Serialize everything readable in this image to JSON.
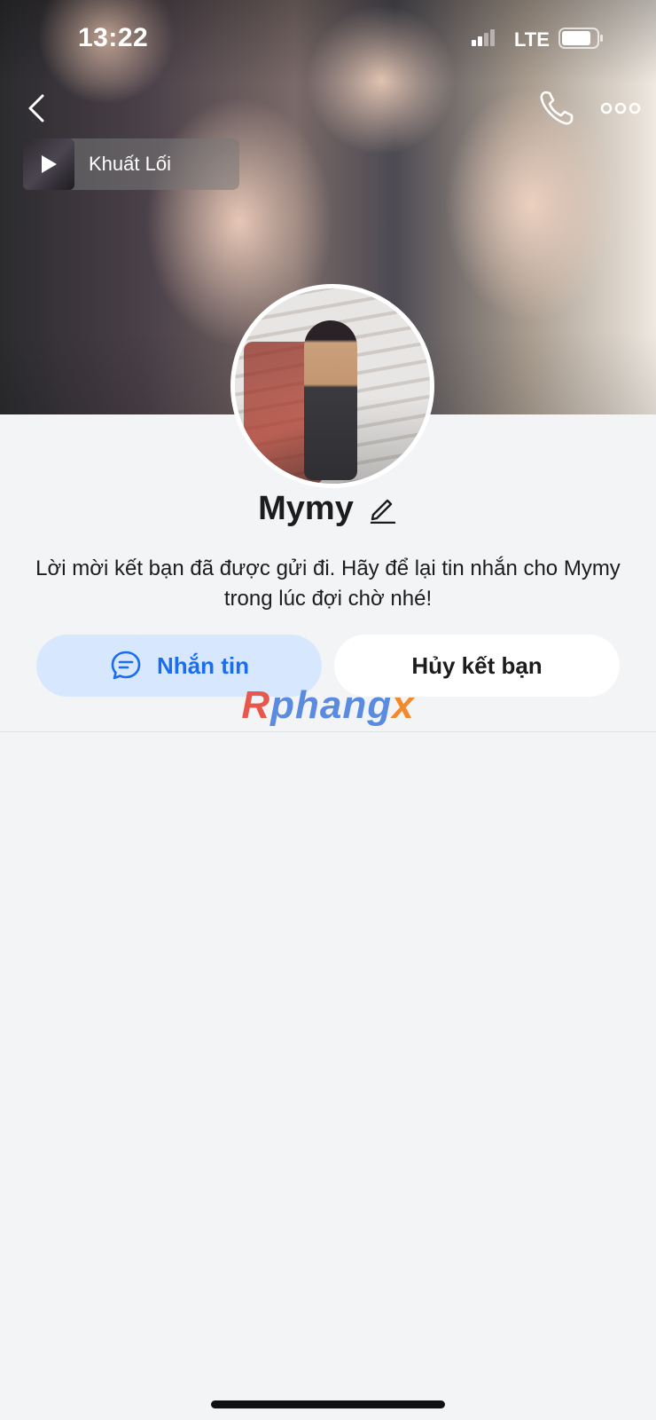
{
  "status_bar": {
    "time": "13:22",
    "network": "LTE",
    "battery_level": 0.85
  },
  "top_nav": {
    "back_icon": "chevron-left-icon",
    "call_icon": "phone-icon",
    "more_icon": "more-horizontal-icon"
  },
  "music": {
    "title": "Khuất Lối",
    "play_icon": "play-icon"
  },
  "profile": {
    "name": "Mymy",
    "edit_icon": "pencil-icon",
    "notice": "Lời mời kết bạn đã được gửi đi. Hãy để lại tin nhắn cho Mymy trong lúc đợi chờ nhé!"
  },
  "actions": {
    "message_label": "Nhắn tin",
    "message_icon": "chat-bubble-icon",
    "unfriend_label": "Hủy kết bạn"
  },
  "watermark": {
    "part1": "R",
    "part2": "phang",
    "part3": "x"
  },
  "colors": {
    "accent": "#1a6cf0",
    "accent_bg": "#d7e8fe",
    "page_bg": "#f3f4f6"
  }
}
